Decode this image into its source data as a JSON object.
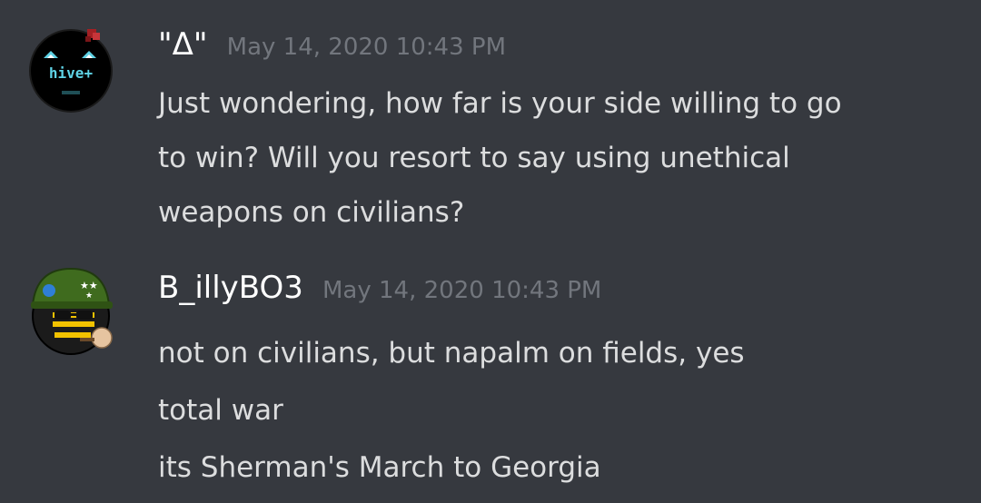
{
  "messages": [
    {
      "username": "\"Δ\"",
      "timestamp": "May 14, 2020 10:43 PM",
      "avatar_icon": "hive-plus-avatar-icon",
      "avatar_text": "hive+",
      "lines": [
        "Just wondering, how far is your side willing to go",
        "to win?  Will you resort to say using unethical",
        "weapons on civilians?"
      ]
    },
    {
      "username": "B_illyBO3",
      "timestamp": "May 14, 2020 10:43 PM",
      "avatar_icon": "soldier-ball-avatar-icon",
      "lines": [
        "not on civilians, but napalm on fields, yes",
        "total war",
        "its Sherman's March to Georgia"
      ]
    }
  ],
  "colors": {
    "background": "#36393f",
    "username": "#ffffff",
    "timestamp": "#72767d",
    "message_text": "#dcddde"
  }
}
